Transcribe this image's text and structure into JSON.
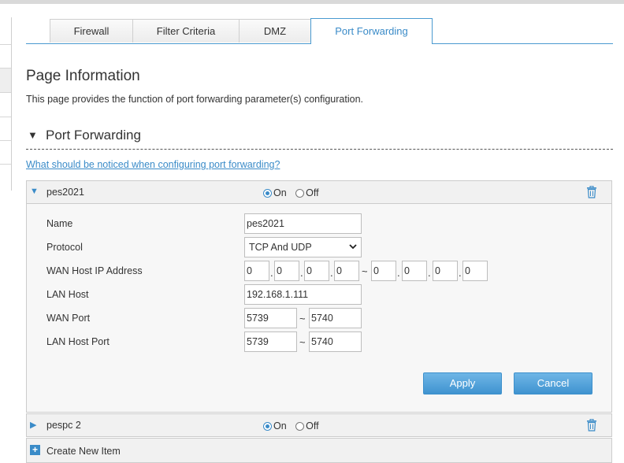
{
  "tabs": [
    {
      "label": "Firewall"
    },
    {
      "label": "Filter Criteria"
    },
    {
      "label": "DMZ"
    },
    {
      "label": "Port Forwarding"
    }
  ],
  "active_tab": "Port Forwarding",
  "page": {
    "title": "Page Information",
    "description": "This page provides the function of port forwarding parameter(s) configuration."
  },
  "section": {
    "title": "Port Forwarding"
  },
  "notice_link": "What should be noticed when configuring port forwarding?",
  "radio": {
    "on": "On",
    "off": "Off"
  },
  "items": [
    {
      "name": "pes2021",
      "enabled": true,
      "expanded": true,
      "form": {
        "labels": {
          "name": "Name",
          "protocol": "Protocol",
          "wan_host_ip": "WAN Host IP Address",
          "lan_host": "LAN Host",
          "wan_port": "WAN Port",
          "lan_host_port": "LAN Host Port"
        },
        "name": "pes2021",
        "protocol": "TCP And UDP",
        "wan_ip_start": [
          "0",
          "0",
          "0",
          "0"
        ],
        "wan_ip_end": [
          "0",
          "0",
          "0",
          "0"
        ],
        "lan_host": "192.168.1.111",
        "wan_port_start": "5739",
        "wan_port_end": "5740",
        "lan_port_start": "5739",
        "lan_port_end": "5740",
        "range_separator": "~",
        "ip_separator": "."
      }
    },
    {
      "name": "pespc 2",
      "enabled": true,
      "expanded": false
    }
  ],
  "buttons": {
    "apply": "Apply",
    "cancel": "Cancel"
  },
  "create_new": "Create New Item",
  "colors": {
    "accent": "#3a8bc8",
    "button": "#4a9ad6",
    "panel_bg": "#f7f7f7",
    "row_bg": "#f1f1f1"
  },
  "icons": {
    "expanded": "triangle-down-icon",
    "collapsed": "triangle-right-icon",
    "delete": "trash-icon",
    "add": "plus-square-icon"
  }
}
